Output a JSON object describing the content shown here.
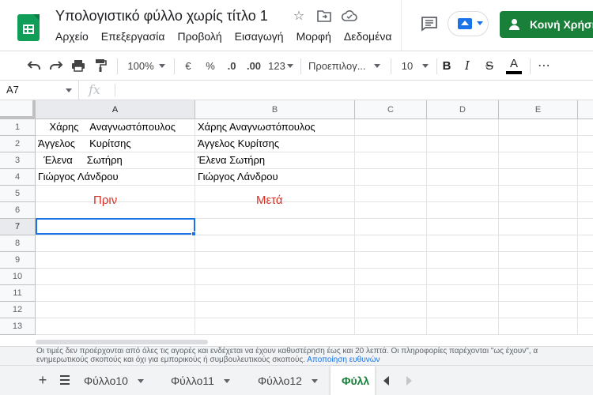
{
  "header": {
    "doc_title": "Υπολογιστικό φύλλο χωρίς τίτλο 1",
    "menu": [
      "Αρχείο",
      "Επεξεργασία",
      "Προβολή",
      "Εισαγωγή",
      "Μορφή",
      "Δεδομένα"
    ],
    "share_label": "Κοινή Χρήση",
    "colors": {
      "share": "#188038",
      "accent": "#1a73e8",
      "logo": "#0f9d58"
    }
  },
  "toolbar": {
    "zoom": "100%",
    "currency": "€",
    "percent": "%",
    "dec_decrease": ".0",
    "dec_increase": ".00",
    "number_format": "123",
    "font": "Προεπιλογ...",
    "font_size": "10",
    "bold": "B",
    "italic": "I",
    "strike": "S",
    "text_color": "A",
    "more": "⋯"
  },
  "formula_bar": {
    "cell_ref": "A7",
    "fx": "fx"
  },
  "grid": {
    "columns": [
      "A",
      "B",
      "C",
      "D",
      "E"
    ],
    "rows": [
      "1",
      "2",
      "3",
      "4",
      "5",
      "6",
      "7",
      "8",
      "9",
      "10",
      "11",
      "12",
      "13"
    ],
    "col_a": [
      "    Χάρης    Αναγνωστόπουλος",
      "Άγγελος     Κυρίτσης",
      "  Έλενα     Σωτήρη",
      "Γιώργος Λάνδρου"
    ],
    "col_b": [
      "Χάρης Αναγνωστόπουλος",
      "Άγγελος Κυρίτσης",
      "Έλενα Σωτήρη",
      "Γιώργος Λάνδρου"
    ],
    "note_before": "Πριν",
    "note_after": "Μετά",
    "selected_cell": "A7"
  },
  "disclaimer": {
    "line1": "Οι τιμές δεν προέρχονται από όλες τις αγορές και ενδέχεται να έχουν καθυστέρηση έως και 20 λεπτά. Οι πληροφορίες παρέχονται \"ως έχουν\", α",
    "line2": "ενημερωτικούς σκοπούς και όχι για εμπορικούς ή συμβουλευτικούς σκοπούς.",
    "link": "Αποποίηση ευθυνών"
  },
  "sheets": {
    "tabs": [
      "Φύλλο10",
      "Φύλλο11",
      "Φύλλο12",
      "Φύλλ"
    ],
    "active_index": 3,
    "add_symbol": "+"
  }
}
